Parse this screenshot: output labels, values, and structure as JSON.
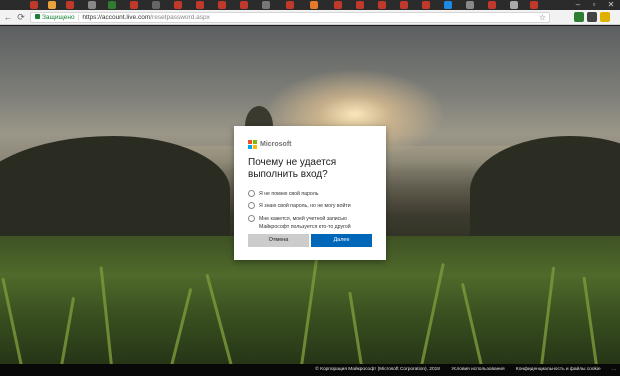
{
  "browser": {
    "secure_label": "Защищено",
    "url_host": "https://account.live.com",
    "url_path": "/resetpassword.aspx"
  },
  "brand": {
    "name": "Microsoft",
    "logo_colors": [
      "#f25022",
      "#7fba00",
      "#00a4ef",
      "#ffb900"
    ]
  },
  "dialog": {
    "title": "Почему не удается выполнить вход?",
    "options": [
      {
        "label": "Я не помню свой пароль"
      },
      {
        "label": "Я знаю свой пароль, но не могу войти"
      },
      {
        "label": "Мне кажется, моей учетной записью Майкрософт пользуется кто-то другой"
      }
    ],
    "cancel_label": "Отмена",
    "next_label": "Далее",
    "accent_color": "#0067b8"
  },
  "footer": {
    "copyright": "© Корпорация Майкрософт (Microsoft Corporation), 2018",
    "terms": "Условия использования",
    "privacy": "Конфиденциальность и файлы cookie",
    "more": "..."
  }
}
